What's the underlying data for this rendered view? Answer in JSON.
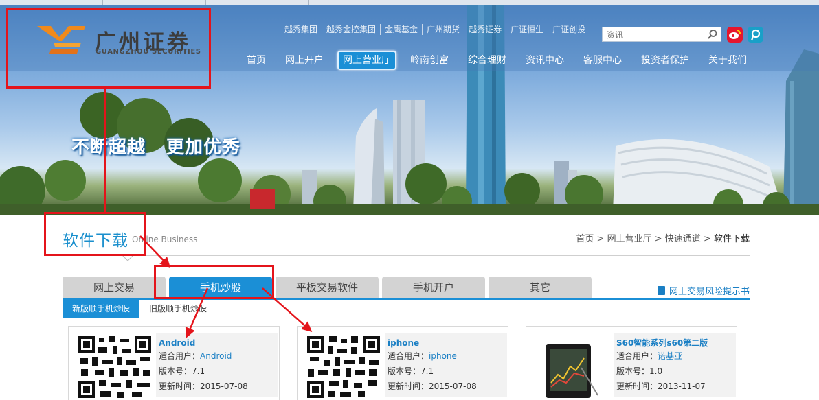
{
  "header": {
    "logo_cn": "广州证券",
    "logo_en": "GUANGZHOU SECURITIES",
    "top_links": [
      "越秀集团",
      "越秀金控集团",
      "金鹰基金",
      "广州期货",
      "越秀证券",
      "广证恒生",
      "广证创投"
    ],
    "search_placeholder": "资讯",
    "nav": [
      "首页",
      "网上开户",
      "网上营业厅",
      "岭南创富",
      "综合理财",
      "资讯中心",
      "客服中心",
      "投资者保护",
      "关于我们"
    ],
    "nav_active_index": 2
  },
  "banner": {
    "slogan_1": "不断超越",
    "slogan_2": "更加优秀"
  },
  "section": {
    "title": "软件下载",
    "subtitle": "Online Business",
    "breadcrumb": [
      "首页",
      "网上营业厅",
      "快速通道",
      "软件下载"
    ],
    "breadcrumb_sep": ">",
    "tabs": [
      "网上交易",
      "手机炒股",
      "平板交易软件",
      "手机开户",
      "其它"
    ],
    "active_tab_index": 1,
    "risk_link": "网上交易风险提示书",
    "subtabs": [
      "新版顺手机炒股",
      "旧版顺手机炒股"
    ],
    "active_subtab_index": 0
  },
  "cards": [
    {
      "name": "Android",
      "user_label": "适合用户：",
      "user_value": "Android",
      "version_label": "版本号：",
      "version": "7.1",
      "date_label": "更新时间：",
      "date": "2015-07-08",
      "image": "qr-code"
    },
    {
      "name": "iphone",
      "user_label": "适合用户：",
      "user_value": "iphone",
      "version_label": "版本号：",
      "version": "7.1",
      "date_label": "更新时间：",
      "date": "2015-07-08",
      "image": "qr-code"
    },
    {
      "name": "S60智能系列s60第二版",
      "user_label": "适合用户：",
      "user_value": "诺基亚",
      "version_label": "版本号：",
      "version": "1.0",
      "date_label": "更新时间：",
      "date": "2013-11-07",
      "image": "phone-image"
    }
  ],
  "colors": {
    "accent": "#1b8fd6",
    "annotation": "#e4141b",
    "logo_orange": "#f08a1c"
  }
}
